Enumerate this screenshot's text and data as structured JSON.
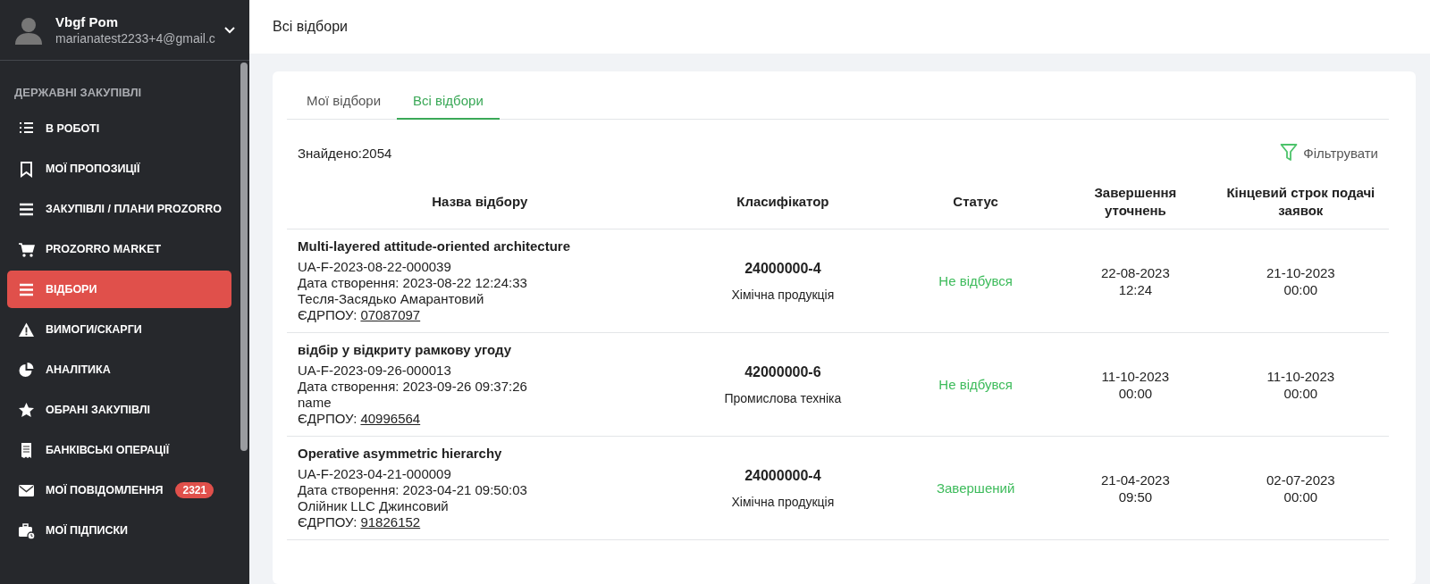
{
  "user": {
    "name": "Vbgf Pom",
    "email": "marianatest2233+4@gmail.c"
  },
  "sidebar": {
    "section": "ДЕРЖАВНІ ЗАКУПІВЛІ",
    "items": [
      {
        "label": "В РОБОТІ",
        "selected": false
      },
      {
        "label": "МОЇ ПРОПОЗИЦІЇ",
        "selected": false
      },
      {
        "label": "ЗАКУПІВЛІ / ПЛАНИ PROZORRO",
        "selected": false
      },
      {
        "label": "PROZORRO MARKET",
        "selected": false
      },
      {
        "label": "ВІДБОРИ",
        "selected": true
      },
      {
        "label": "ВИМОГИ/СКАРГИ",
        "selected": false
      },
      {
        "label": "АНАЛІТИКА",
        "selected": false
      },
      {
        "label": "ОБРАНІ ЗАКУПІВЛІ",
        "selected": false
      },
      {
        "label": "БАНКІВСЬКІ ОПЕРАЦІЇ",
        "selected": false
      },
      {
        "label": "МОЇ ПОВІДОМЛЕННЯ",
        "selected": false,
        "badge": "2321"
      },
      {
        "label": "МОЇ ПІДПИСКИ",
        "selected": false
      }
    ]
  },
  "page_title": "Всі відбори",
  "tabs": [
    {
      "label": "Мої відбори",
      "selected": false
    },
    {
      "label": "Всі відбори",
      "selected": true
    }
  ],
  "found": "Знайдено:2054",
  "filter_button": "Фільтрувати",
  "table": {
    "columns": [
      "Назва відбору",
      "Класифікатор",
      "Статус",
      "Завершення уточнень",
      "Кінцевий строк подачі заявок"
    ],
    "rows": [
      {
        "title": "Multi-layered attitude-oriented architecture",
        "code": "UA-F-2023-08-22-000039",
        "created": "Дата створення: 2023-08-22 12:24:33",
        "organization": "Тесля-Засядько Амарантовий",
        "edrpou_label": "ЄДРПОУ:",
        "edrpou": "07087097",
        "classifier_code": "24000000-4",
        "classifier_name": "Хімічна продукція",
        "status": "Не відбувся",
        "clarification_date": "22-08-2023",
        "clarification_time": "12:24",
        "deadline_date": "21-10-2023",
        "deadline_time": "00:00"
      },
      {
        "title": "відбір у відкриту рамкову угоду",
        "code": "UA-F-2023-09-26-000013",
        "created": "Дата створення: 2023-09-26 09:37:26",
        "organization": "name",
        "edrpou_label": "ЄДРПОУ:",
        "edrpou": "40996564",
        "classifier_code": "42000000-6",
        "classifier_name": "Промислова техніка",
        "status": "Не відбувся",
        "clarification_date": "11-10-2023",
        "clarification_time": "00:00",
        "deadline_date": "11-10-2023",
        "deadline_time": "00:00"
      },
      {
        "title": "Operative asymmetric hierarchy",
        "code": "UA-F-2023-04-21-000009",
        "created": "Дата створення: 2023-04-21 09:50:03",
        "organization": "Олійник LLC Джинсовий",
        "edrpou_label": "ЄДРПОУ:",
        "edrpou": "91826152",
        "classifier_code": "24000000-4",
        "classifier_name": "Хімічна продукція",
        "status": "Завершений",
        "clarification_date": "21-04-2023",
        "clarification_time": "09:50",
        "deadline_date": "02-07-2023",
        "deadline_time": "00:00"
      }
    ]
  }
}
